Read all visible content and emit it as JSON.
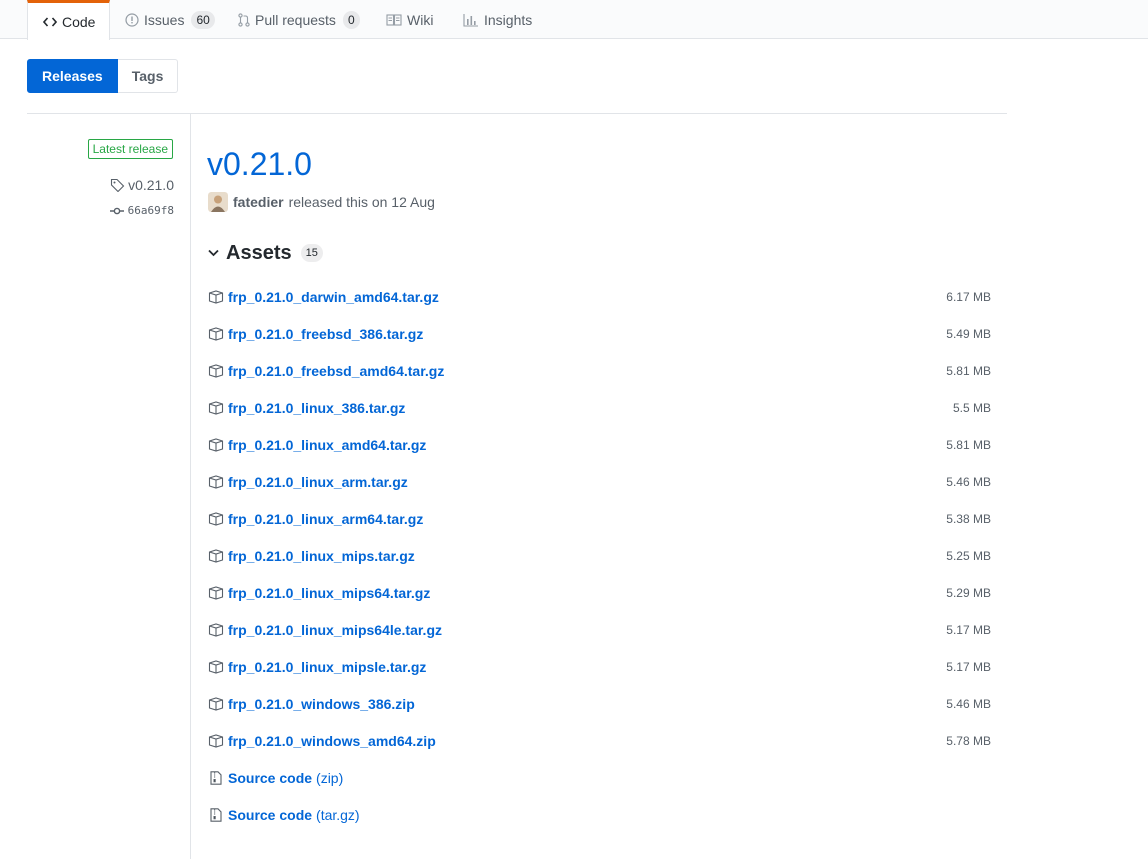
{
  "nav": {
    "code": "Code",
    "issues": "Issues",
    "issues_count": "60",
    "pull_requests": "Pull requests",
    "pull_requests_count": "0",
    "wiki": "Wiki",
    "insights": "Insights"
  },
  "subnav": {
    "releases": "Releases",
    "tags": "Tags"
  },
  "release": {
    "latest_label": "Latest release",
    "tag": "v0.21.0",
    "commit": "66a69f8",
    "title": "v0.21.0",
    "author": "fatedier",
    "released_text": "released this on 12 Aug"
  },
  "assets": {
    "title": "Assets",
    "count": "15",
    "files": [
      {
        "name": "frp_0.21.0_darwin_amd64.tar.gz",
        "size": "6.17 MB"
      },
      {
        "name": "frp_0.21.0_freebsd_386.tar.gz",
        "size": "5.49 MB"
      },
      {
        "name": "frp_0.21.0_freebsd_amd64.tar.gz",
        "size": "5.81 MB"
      },
      {
        "name": "frp_0.21.0_linux_386.tar.gz",
        "size": "5.5 MB"
      },
      {
        "name": "frp_0.21.0_linux_amd64.tar.gz",
        "size": "5.81 MB"
      },
      {
        "name": "frp_0.21.0_linux_arm.tar.gz",
        "size": "5.46 MB"
      },
      {
        "name": "frp_0.21.0_linux_arm64.tar.gz",
        "size": "5.38 MB"
      },
      {
        "name": "frp_0.21.0_linux_mips.tar.gz",
        "size": "5.25 MB"
      },
      {
        "name": "frp_0.21.0_linux_mips64.tar.gz",
        "size": "5.29 MB"
      },
      {
        "name": "frp_0.21.0_linux_mips64le.tar.gz",
        "size": "5.17 MB"
      },
      {
        "name": "frp_0.21.0_linux_mipsle.tar.gz",
        "size": "5.17 MB"
      },
      {
        "name": "frp_0.21.0_windows_386.zip",
        "size": "5.46 MB"
      },
      {
        "name": "frp_0.21.0_windows_amd64.zip",
        "size": "5.78 MB"
      }
    ],
    "source": [
      {
        "label": "Source code",
        "format": "(zip)"
      },
      {
        "label": "Source code",
        "format": "(tar.gz)"
      }
    ]
  },
  "colors": {
    "link": "#0366d6",
    "selected_tab_accent": "#e36209",
    "latest_release_green": "#28a745"
  }
}
